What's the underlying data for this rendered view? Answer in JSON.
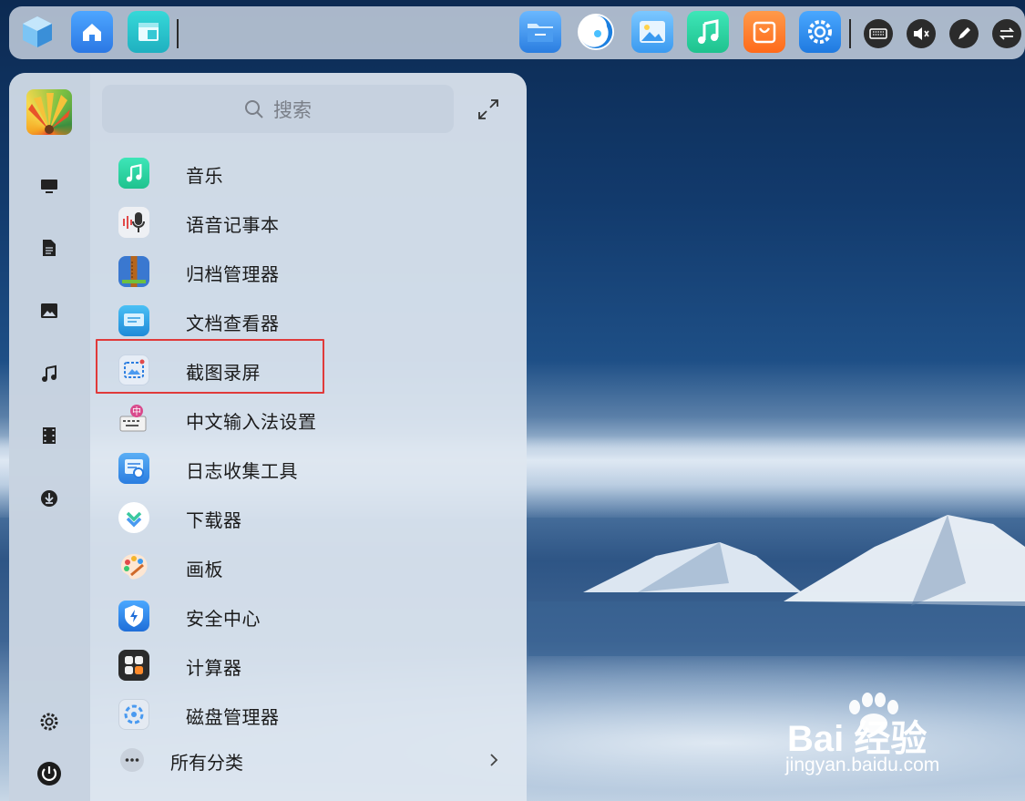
{
  "dock": {
    "apps": [
      {
        "name": "cube-icon",
        "color": "#5aa8e8"
      },
      {
        "name": "home-icon",
        "color": "#3a8ef0"
      },
      {
        "name": "multitask-icon",
        "color": "#2bc4c9"
      },
      {
        "name": "folder-icon",
        "color": "#3a8ef0"
      },
      {
        "name": "browser-icon",
        "color": "#1b7fe0"
      },
      {
        "name": "gallery-icon",
        "color": "#4ab0f0"
      },
      {
        "name": "music-icon",
        "color": "#2ad6a0"
      },
      {
        "name": "store-icon",
        "color": "#ff7a2a"
      },
      {
        "name": "settings-icon",
        "color": "#2a8ae8"
      }
    ],
    "tray": [
      "keyboard-icon",
      "volume-muted-icon",
      "pen-icon",
      "swap-icon"
    ]
  },
  "launcher": {
    "search_placeholder": "搜索",
    "rail": [
      "monitor-icon",
      "document-icon",
      "image-icon",
      "music-note-icon",
      "film-icon",
      "download-icon",
      "settings-gear-icon",
      "power-icon"
    ],
    "apps": [
      {
        "label": "音乐",
        "icon": "music-app-icon",
        "color": "#2fd3a8"
      },
      {
        "label": "语音记事本",
        "icon": "voice-note-icon",
        "color": "#e8e8ee"
      },
      {
        "label": "归档管理器",
        "icon": "archive-icon",
        "color": "#3a78d0"
      },
      {
        "label": "文档查看器",
        "icon": "doc-viewer-icon",
        "color": "#2aa6e6"
      },
      {
        "label": "截图录屏",
        "icon": "screenshot-icon",
        "color": "#e6edf6"
      },
      {
        "label": "中文输入法设置",
        "icon": "input-method-icon",
        "color": "#f0f0f0"
      },
      {
        "label": "日志收集工具",
        "icon": "log-collector-icon",
        "color": "#3e8ede"
      },
      {
        "label": "下载器",
        "icon": "downloader-icon",
        "color": "#ffffff"
      },
      {
        "label": "画板",
        "icon": "paint-icon",
        "color": "#fde4d0"
      },
      {
        "label": "安全中心",
        "icon": "security-center-icon",
        "color": "#2a7be0"
      },
      {
        "label": "计算器",
        "icon": "calculator-icon",
        "color": "#2b2b2b"
      },
      {
        "label": "磁盘管理器",
        "icon": "disk-manager-icon",
        "color": "#e4eaf2"
      }
    ],
    "all_categories": "所有分类"
  },
  "watermark": {
    "main": "Bai  经验",
    "sub": "jingyan.baidu.com"
  }
}
